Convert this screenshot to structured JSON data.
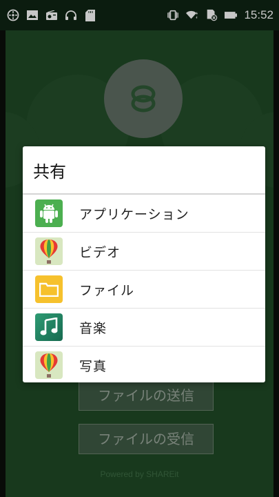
{
  "status_bar": {
    "time": "15:52",
    "left_icons": [
      "clock-icon",
      "image-icon",
      "radio-icon",
      "headphones-icon",
      "sd-card-icon"
    ],
    "right_icons": [
      "vibrate-icon",
      "wifi-icon",
      "sim-no-signal-icon",
      "battery-icon"
    ]
  },
  "background": {
    "send_button": "ファイルの送信",
    "receive_button": "ファイルの受信",
    "powered_by": "Powered by SHAREit"
  },
  "dialog": {
    "title": "共有",
    "items": [
      {
        "label": "アプリケーション",
        "icon": "android-icon"
      },
      {
        "label": "ビデオ",
        "icon": "video-balloon-icon"
      },
      {
        "label": "ファイル",
        "icon": "folder-icon"
      },
      {
        "label": "音楽",
        "icon": "music-note-icon"
      },
      {
        "label": "写真",
        "icon": "photo-balloon-icon"
      }
    ]
  },
  "colors": {
    "app_background": "#1f4a26",
    "status_bar": "#0f2414",
    "dialog_background": "#ffffff",
    "android_green": "#4caf50",
    "folder_yellow": "#f6c12d",
    "music_teal": "#1f8f6e"
  }
}
